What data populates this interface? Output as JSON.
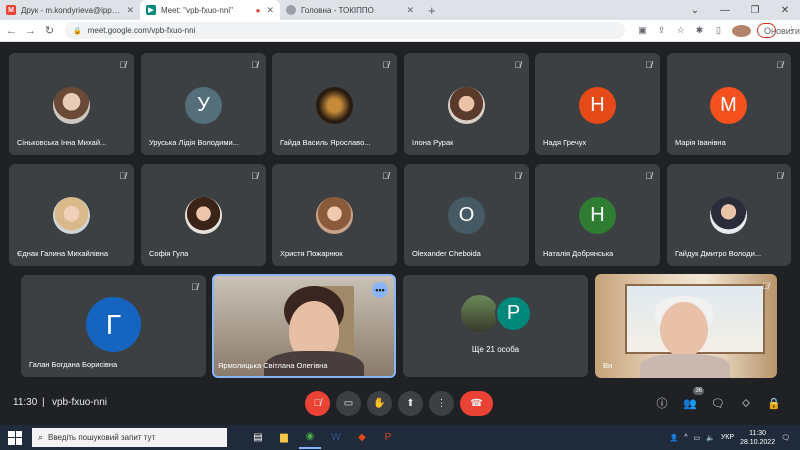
{
  "browser": {
    "tabs": [
      {
        "title": "Друк - m.kondyrieva@ippo.edu",
        "icon": "gmail-icon",
        "color": "#ea4335"
      },
      {
        "title": "Meet: \"vpb-fxuo-nni\"",
        "icon": "meet-icon",
        "color": "#00897b"
      },
      {
        "title": "Головна - ТОКІППО",
        "icon": "globe-icon",
        "color": "#5f6368"
      }
    ],
    "url": "meet.google.com/vpb-fxuo-nni",
    "update_label": "Оновити"
  },
  "participants_row1": [
    {
      "name": "Сіньковська Інна Михай...",
      "type": "photo"
    },
    {
      "name": "Уруська Лідія Володими...",
      "type": "letter",
      "letter": "У",
      "color": "#546e7a"
    },
    {
      "name": "Гайда Василь Ярославо...",
      "type": "photo"
    },
    {
      "name": "Ілона Рурак",
      "type": "photo"
    },
    {
      "name": "Надя Гречух",
      "type": "letter",
      "letter": "Н",
      "color": "#e64a19"
    },
    {
      "name": "Марія Іванівна",
      "type": "letter",
      "letter": "М",
      "color": "#f4511e"
    }
  ],
  "participants_row2": [
    {
      "name": "Єднак Галина Михайлівна",
      "type": "photo"
    },
    {
      "name": "Софія Гула",
      "type": "photo"
    },
    {
      "name": "Христя Пожарнюк",
      "type": "photo"
    },
    {
      "name": "Olexander Cheboida",
      "type": "letter",
      "letter": "O",
      "color": "#455a64"
    },
    {
      "name": "Наталія Добрянська",
      "type": "letter",
      "letter": "Н",
      "color": "#2e7d32"
    },
    {
      "name": "Гайдук Дмитро Володи...",
      "type": "photo"
    }
  ],
  "row3": {
    "galan": {
      "name": "Галан Богдана Борисівна",
      "letter": "Г",
      "color": "#1565c0"
    },
    "speaker": {
      "name": "Ярмолицька Світлана Олегівна"
    },
    "others": {
      "label": "Ще 21 особа",
      "letter": "P",
      "color": "#00897b"
    },
    "self": {
      "name": "Ви"
    }
  },
  "meeting": {
    "time": "11:30",
    "separator": "|",
    "code": "vpb-fxuo-nni",
    "people_count": "36"
  },
  "taskbar": {
    "search_placeholder": "Введіть пошуковий запит тут",
    "language": "УКР",
    "clock_time": "11:30",
    "clock_date": "28.10.2022"
  }
}
